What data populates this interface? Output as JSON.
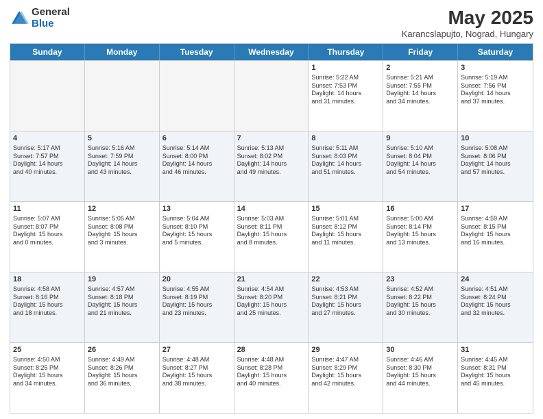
{
  "header": {
    "logo_general": "General",
    "logo_blue": "Blue",
    "month_title": "May 2025",
    "subtitle": "Karancslapujto, Nograd, Hungary"
  },
  "days_of_week": [
    "Sunday",
    "Monday",
    "Tuesday",
    "Wednesday",
    "Thursday",
    "Friday",
    "Saturday"
  ],
  "weeks": [
    [
      {
        "day": "",
        "text": "",
        "empty": true
      },
      {
        "day": "",
        "text": "",
        "empty": true
      },
      {
        "day": "",
        "text": "",
        "empty": true
      },
      {
        "day": "",
        "text": "",
        "empty": true
      },
      {
        "day": "1",
        "text": "Sunrise: 5:22 AM\nSunset: 7:53 PM\nDaylight: 14 hours\nand 31 minutes."
      },
      {
        "day": "2",
        "text": "Sunrise: 5:21 AM\nSunset: 7:55 PM\nDaylight: 14 hours\nand 34 minutes."
      },
      {
        "day": "3",
        "text": "Sunrise: 5:19 AM\nSunset: 7:56 PM\nDaylight: 14 hours\nand 37 minutes."
      }
    ],
    [
      {
        "day": "4",
        "text": "Sunrise: 5:17 AM\nSunset: 7:57 PM\nDaylight: 14 hours\nand 40 minutes."
      },
      {
        "day": "5",
        "text": "Sunrise: 5:16 AM\nSunset: 7:59 PM\nDaylight: 14 hours\nand 43 minutes."
      },
      {
        "day": "6",
        "text": "Sunrise: 5:14 AM\nSunset: 8:00 PM\nDaylight: 14 hours\nand 46 minutes."
      },
      {
        "day": "7",
        "text": "Sunrise: 5:13 AM\nSunset: 8:02 PM\nDaylight: 14 hours\nand 49 minutes."
      },
      {
        "day": "8",
        "text": "Sunrise: 5:11 AM\nSunset: 8:03 PM\nDaylight: 14 hours\nand 51 minutes."
      },
      {
        "day": "9",
        "text": "Sunrise: 5:10 AM\nSunset: 8:04 PM\nDaylight: 14 hours\nand 54 minutes."
      },
      {
        "day": "10",
        "text": "Sunrise: 5:08 AM\nSunset: 8:06 PM\nDaylight: 14 hours\nand 57 minutes."
      }
    ],
    [
      {
        "day": "11",
        "text": "Sunrise: 5:07 AM\nSunset: 8:07 PM\nDaylight: 15 hours\nand 0 minutes."
      },
      {
        "day": "12",
        "text": "Sunrise: 5:05 AM\nSunset: 8:08 PM\nDaylight: 15 hours\nand 3 minutes."
      },
      {
        "day": "13",
        "text": "Sunrise: 5:04 AM\nSunset: 8:10 PM\nDaylight: 15 hours\nand 5 minutes."
      },
      {
        "day": "14",
        "text": "Sunrise: 5:03 AM\nSunset: 8:11 PM\nDaylight: 15 hours\nand 8 minutes."
      },
      {
        "day": "15",
        "text": "Sunrise: 5:01 AM\nSunset: 8:12 PM\nDaylight: 15 hours\nand 11 minutes."
      },
      {
        "day": "16",
        "text": "Sunrise: 5:00 AM\nSunset: 8:14 PM\nDaylight: 15 hours\nand 13 minutes."
      },
      {
        "day": "17",
        "text": "Sunrise: 4:59 AM\nSunset: 8:15 PM\nDaylight: 15 hours\nand 16 minutes."
      }
    ],
    [
      {
        "day": "18",
        "text": "Sunrise: 4:58 AM\nSunset: 8:16 PM\nDaylight: 15 hours\nand 18 minutes."
      },
      {
        "day": "19",
        "text": "Sunrise: 4:57 AM\nSunset: 8:18 PM\nDaylight: 15 hours\nand 21 minutes."
      },
      {
        "day": "20",
        "text": "Sunrise: 4:55 AM\nSunset: 8:19 PM\nDaylight: 15 hours\nand 23 minutes."
      },
      {
        "day": "21",
        "text": "Sunrise: 4:54 AM\nSunset: 8:20 PM\nDaylight: 15 hours\nand 25 minutes."
      },
      {
        "day": "22",
        "text": "Sunrise: 4:53 AM\nSunset: 8:21 PM\nDaylight: 15 hours\nand 27 minutes."
      },
      {
        "day": "23",
        "text": "Sunrise: 4:52 AM\nSunset: 8:22 PM\nDaylight: 15 hours\nand 30 minutes."
      },
      {
        "day": "24",
        "text": "Sunrise: 4:51 AM\nSunset: 8:24 PM\nDaylight: 15 hours\nand 32 minutes."
      }
    ],
    [
      {
        "day": "25",
        "text": "Sunrise: 4:50 AM\nSunset: 8:25 PM\nDaylight: 15 hours\nand 34 minutes."
      },
      {
        "day": "26",
        "text": "Sunrise: 4:49 AM\nSunset: 8:26 PM\nDaylight: 15 hours\nand 36 minutes."
      },
      {
        "day": "27",
        "text": "Sunrise: 4:48 AM\nSunset: 8:27 PM\nDaylight: 15 hours\nand 38 minutes."
      },
      {
        "day": "28",
        "text": "Sunrise: 4:48 AM\nSunset: 8:28 PM\nDaylight: 15 hours\nand 40 minutes."
      },
      {
        "day": "29",
        "text": "Sunrise: 4:47 AM\nSunset: 8:29 PM\nDaylight: 15 hours\nand 42 minutes."
      },
      {
        "day": "30",
        "text": "Sunrise: 4:46 AM\nSunset: 8:30 PM\nDaylight: 15 hours\nand 44 minutes."
      },
      {
        "day": "31",
        "text": "Sunrise: 4:45 AM\nSunset: 8:31 PM\nDaylight: 15 hours\nand 45 minutes."
      }
    ]
  ]
}
